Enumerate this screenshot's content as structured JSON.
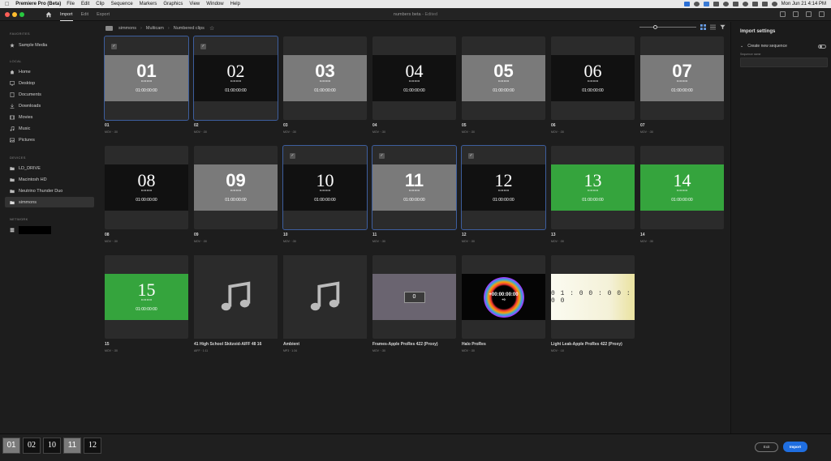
{
  "menubar": {
    "app_name": "Premiere Pro (Beta)",
    "items": [
      "File",
      "Edit",
      "Clip",
      "Sequence",
      "Markers",
      "Graphics",
      "View",
      "Window",
      "Help"
    ],
    "clock": "Mon Jun 21  4:14 PM"
  },
  "topbar": {
    "tabs": [
      "Import",
      "Edit",
      "Export"
    ],
    "active_tab": "Import",
    "doc_title": "numbers beta",
    "doc_status": "- Edited"
  },
  "sidebar": {
    "favorites_header": "FAVORITES",
    "favorites": [
      {
        "label": "Sample Media",
        "icon": "star-icon"
      }
    ],
    "local_header": "LOCAL",
    "local": [
      {
        "label": "Home",
        "icon": "home-icon"
      },
      {
        "label": "Desktop",
        "icon": "desktop-icon"
      },
      {
        "label": "Documents",
        "icon": "documents-icon"
      },
      {
        "label": "Downloads",
        "icon": "downloads-icon"
      },
      {
        "label": "Movies",
        "icon": "movies-icon"
      },
      {
        "label": "Music",
        "icon": "music-icon"
      },
      {
        "label": "Pictures",
        "icon": "pictures-icon"
      }
    ],
    "devices_header": "DEVICES",
    "devices": [
      {
        "label": "LD_DRIVE",
        "icon": "folder-icon"
      },
      {
        "label": "Macintosh HD",
        "icon": "folder-icon"
      },
      {
        "label": "Neutrino Thunder Duo",
        "icon": "folder-icon"
      },
      {
        "label": "simmons",
        "icon": "folder-icon",
        "selected": true
      }
    ],
    "network_header": "NETWORK"
  },
  "breadcrumb": [
    "simmons",
    "Multicam",
    "Numbered clips"
  ],
  "view": {
    "zoom": 0.25
  },
  "clips": [
    {
      "name": "01",
      "meta": "MOV · :30",
      "thumb": "01",
      "tc": "01:00:00:00",
      "style": "gray",
      "selected": true
    },
    {
      "name": "02",
      "meta": "MOV · :30",
      "thumb": "02",
      "tc": "01:00:00:00",
      "style": "dark-serif",
      "selected": true
    },
    {
      "name": "03",
      "meta": "MOV · :30",
      "thumb": "03",
      "tc": "01:00:00:00",
      "style": "gray",
      "selected": false
    },
    {
      "name": "04",
      "meta": "MOV · :30",
      "thumb": "04",
      "tc": "01:00:00:00",
      "style": "dark-serif",
      "selected": false
    },
    {
      "name": "05",
      "meta": "MOV · :30",
      "thumb": "05",
      "tc": "01:00:00:00",
      "style": "gray",
      "selected": false
    },
    {
      "name": "06",
      "meta": "MOV · :30",
      "thumb": "06",
      "tc": "01:00:00:00",
      "style": "dark-serif",
      "selected": false
    },
    {
      "name": "07",
      "meta": "MOV · :30",
      "thumb": "07",
      "tc": "01:00:00:00",
      "style": "gray",
      "selected": false
    },
    {
      "name": "08",
      "meta": "MOV · :30",
      "thumb": "08",
      "tc": "01:00:00:00",
      "style": "dark-serif",
      "selected": false
    },
    {
      "name": "09",
      "meta": "MOV · :30",
      "thumb": "09",
      "tc": "01:00:00:00",
      "style": "gray",
      "selected": false
    },
    {
      "name": "10",
      "meta": "MOV · :30",
      "thumb": "10",
      "tc": "01:00:00:00",
      "style": "dark-serif",
      "selected": true
    },
    {
      "name": "11",
      "meta": "MOV · :30",
      "thumb": "11",
      "tc": "01:00:00:00",
      "style": "gray",
      "selected": true
    },
    {
      "name": "12",
      "meta": "MOV · :30",
      "thumb": "12",
      "tc": "01:00:00:00",
      "style": "dark-serif",
      "selected": true
    },
    {
      "name": "13",
      "meta": "MOV · :30",
      "thumb": "13",
      "tc": "01:00:00:00",
      "style": "green-serif",
      "selected": false
    },
    {
      "name": "14",
      "meta": "MOV · :30",
      "thumb": "14",
      "tc": "01:00:00:00",
      "style": "green-serif",
      "selected": false
    },
    {
      "name": "15",
      "meta": "MOV · :30",
      "thumb": "15",
      "tc": "01:00:00:00",
      "style": "green-serif",
      "selected": false
    },
    {
      "name": "41 High School Skitzoid-AIFF 48 16",
      "meta": "AIFF · 1:11",
      "style": "music",
      "selected": false
    },
    {
      "name": "Ambient",
      "meta": "MP3 · 1:34",
      "style": "music",
      "selected": false
    },
    {
      "name": "Frames-Apple ProRes 422 (Proxy)",
      "meta": "MOV · :30",
      "thumb": "0",
      "style": "frames",
      "selected": false
    },
    {
      "name": "Halo ProRes",
      "meta": "MOV · :30",
      "thumb": "+00:00:00:00",
      "thumb2": "+0",
      "style": "halo",
      "selected": false
    },
    {
      "name": "Light Leak-Apple ProRes 422 (Proxy)",
      "meta": "MOV · :10",
      "thumb": "0 1 : 0 0 : 0 0 : 0 0",
      "style": "leak",
      "selected": false
    }
  ],
  "import_settings": {
    "title": "Import settings",
    "create_sequence_label": "Create new sequence",
    "create_sequence_on": false,
    "sequence_name_label": "Sequence name"
  },
  "selection_tray": [
    {
      "label": "01",
      "style": "gray"
    },
    {
      "label": "02",
      "style": "dark-serif"
    },
    {
      "label": "10",
      "style": "dark-serif"
    },
    {
      "label": "11",
      "style": "gray"
    },
    {
      "label": "12",
      "style": "dark-serif"
    }
  ],
  "footer": {
    "exit_label": "Exit",
    "import_label": "Import"
  },
  "colors": {
    "accent": "#1f6ee0",
    "selection_outline": "#3d5e9e",
    "green_clip": "#35a43d"
  }
}
